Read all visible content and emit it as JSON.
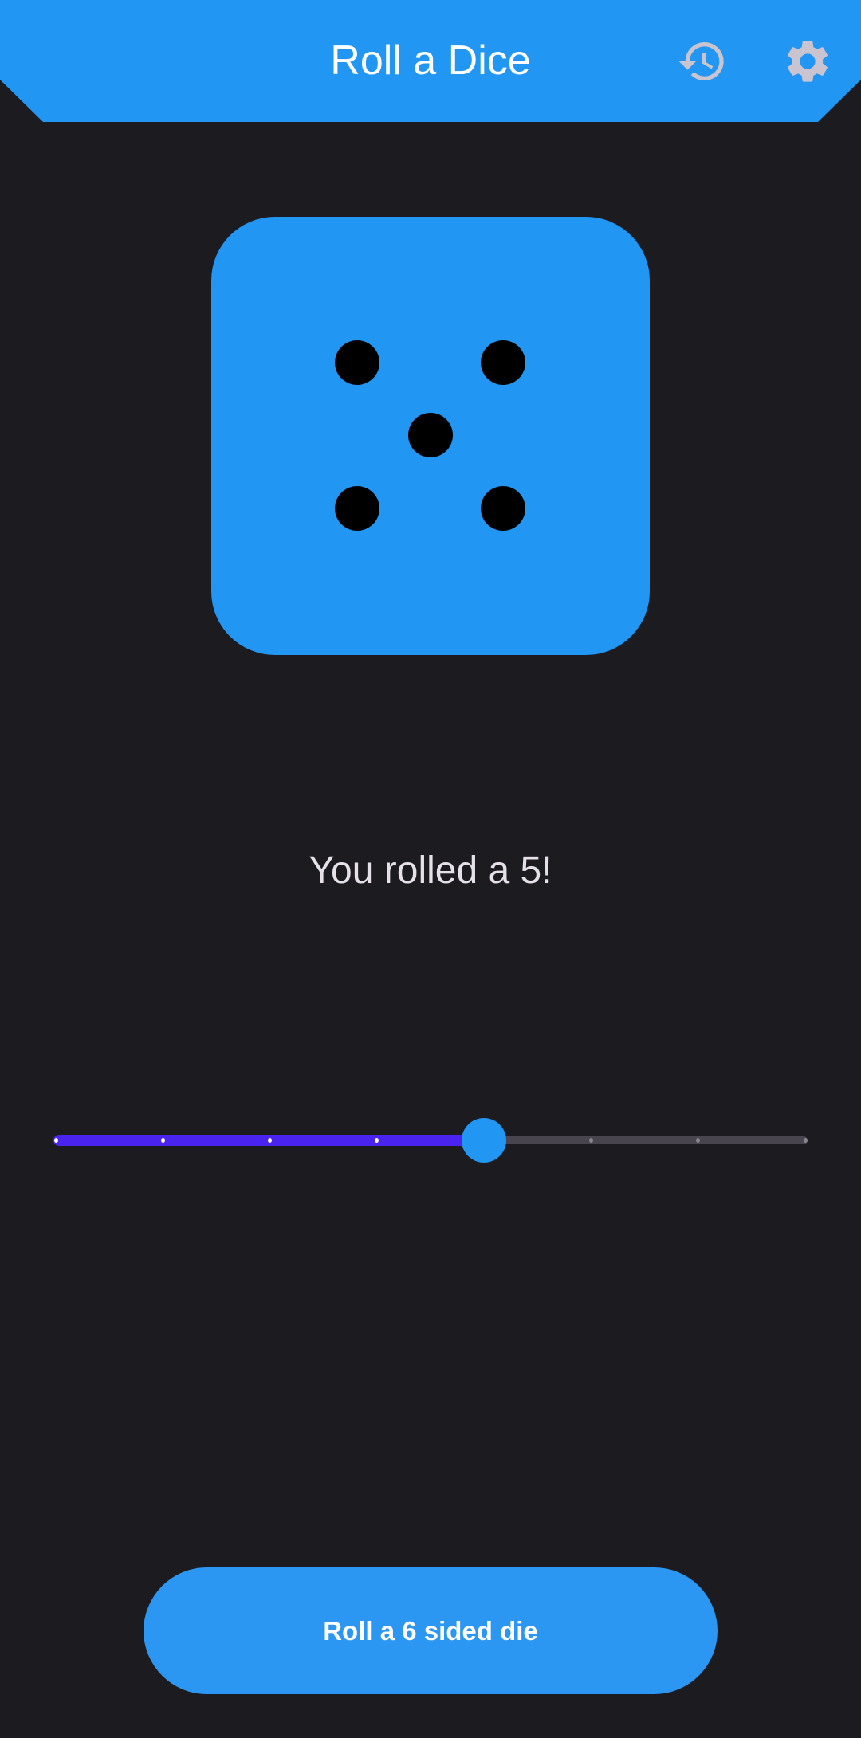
{
  "app_bar": {
    "title": "Roll a Dice",
    "actions": [
      {
        "icon": "history-icon"
      },
      {
        "icon": "settings-gear-icon"
      }
    ],
    "background": "#2196f3"
  },
  "die": {
    "face_value": 5,
    "color": "#2196f3",
    "pip_color": "#000000"
  },
  "result_text": "You rolled a 5!",
  "slider": {
    "divisions": 7,
    "value_fraction": 0.5714,
    "active_color": "#4a24ee",
    "thumb_color": "#2196f3",
    "inactive_color": "#48454e"
  },
  "roll_button": {
    "label": "Roll a 6 sided die",
    "color": "#2b97f3"
  }
}
